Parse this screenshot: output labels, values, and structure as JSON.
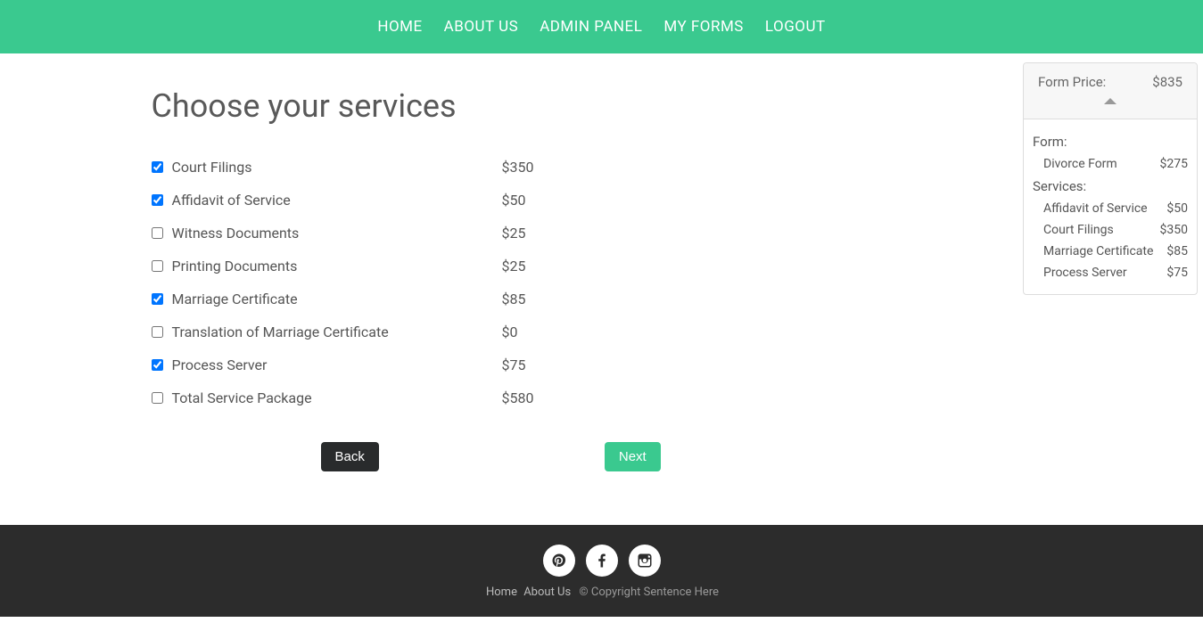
{
  "nav": {
    "items": [
      {
        "label": "HOME"
      },
      {
        "label": "ABOUT US"
      },
      {
        "label": "ADMIN PANEL"
      },
      {
        "label": "MY FORMS"
      },
      {
        "label": "LOGOUT"
      }
    ]
  },
  "page": {
    "title": "Choose your services"
  },
  "services": [
    {
      "label": "Court Filings",
      "price": "$350",
      "checked": true
    },
    {
      "label": "Affidavit of Service",
      "price": "$50",
      "checked": true
    },
    {
      "label": "Witness Documents",
      "price": "$25",
      "checked": false
    },
    {
      "label": "Printing Documents",
      "price": "$25",
      "checked": false
    },
    {
      "label": "Marriage Certificate",
      "price": "$85",
      "checked": true
    },
    {
      "label": "Translation of Marriage Certificate",
      "price": "$0",
      "checked": false
    },
    {
      "label": "Process Server",
      "price": "$75",
      "checked": true
    },
    {
      "label": "Total Service Package",
      "price": "$580",
      "checked": false
    }
  ],
  "buttons": {
    "back": "Back",
    "next": "Next"
  },
  "sidebar": {
    "price_label": "Form Price:",
    "price_value": "$835",
    "form_section_label": "Form:",
    "form_items": [
      {
        "name": "Divorce Form",
        "price": "$275"
      }
    ],
    "services_section_label": "Services:",
    "service_items": [
      {
        "name": "Affidavit of Service",
        "price": "$50"
      },
      {
        "name": "Court Filings",
        "price": "$350"
      },
      {
        "name": "Marriage Certificate",
        "price": "$85"
      },
      {
        "name": "Process Server",
        "price": "$75"
      }
    ]
  },
  "footer": {
    "links": [
      {
        "label": "Home"
      },
      {
        "label": "About Us"
      }
    ],
    "copyright": "© Copyright Sentence Here"
  }
}
